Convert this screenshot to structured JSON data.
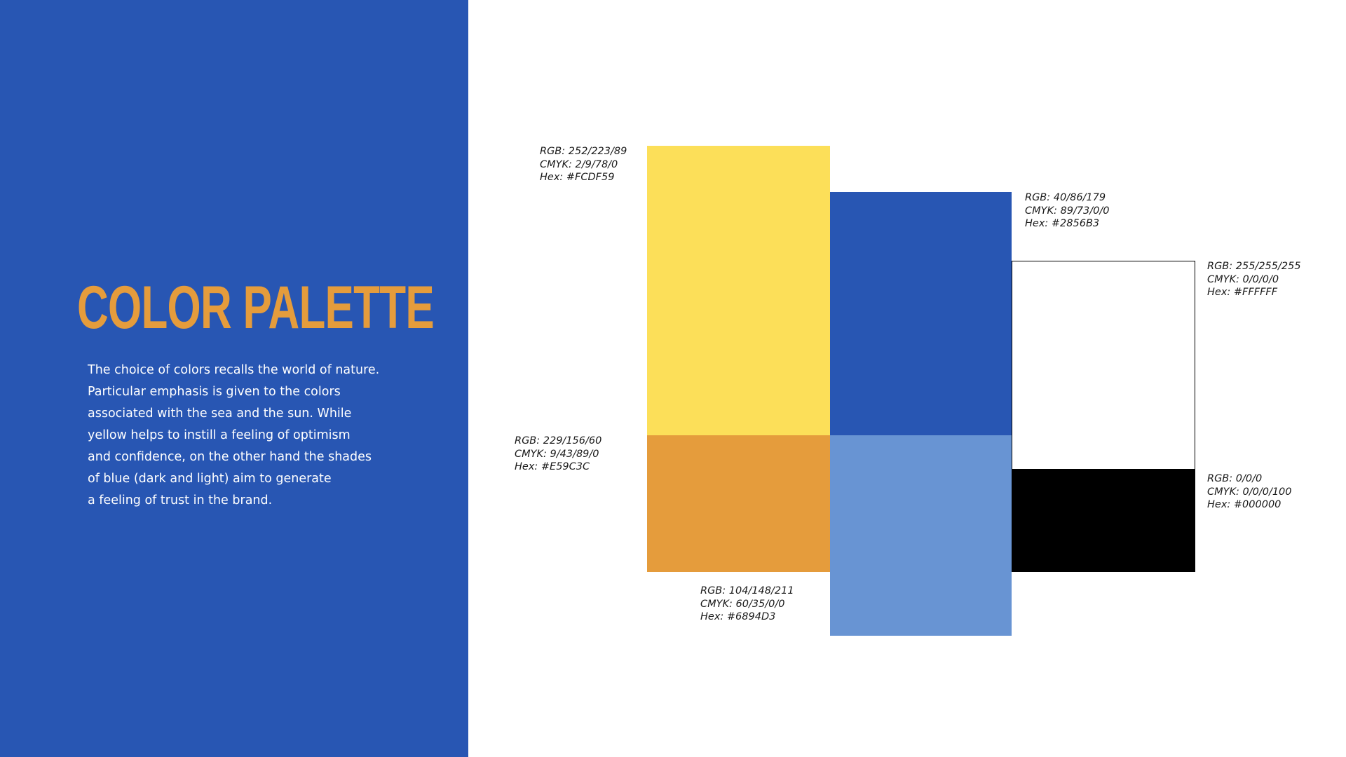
{
  "title": "COLOR PALETTE",
  "description_lines": [
    "The choice of colors recalls the world of nature.",
    "Particular emphasis is given to the colors",
    "associated with the sea and the sun. While",
    "yellow helps to instill a feeling of optimism",
    "and confidence, on the other hand the shades",
    "of blue (dark and light) aim to generate",
    "a feeling of trust in the brand."
  ],
  "colors": {
    "panel_background": "#2856B3",
    "title": "#E59C3C",
    "description_text": "#FFFFFF"
  },
  "swatches": {
    "yellow": {
      "color": "#FCDF59",
      "rgb": "RGB: 252/223/89",
      "cmyk": "CMYK: 2/9/78/0",
      "hex": "Hex: #FCDF59"
    },
    "blue": {
      "color": "#2856B3",
      "rgb": "RGB: 40/86/179",
      "cmyk": "CMYK: 89/73/0/0",
      "hex": "Hex: #2856B3"
    },
    "white": {
      "color": "#FFFFFF",
      "rgb": "RGB: 255/255/255",
      "cmyk": "CMYK: 0/0/0/0",
      "hex": "Hex: #FFFFFF"
    },
    "orange": {
      "color": "#E59C3C",
      "rgb": "RGB: 229/156/60",
      "cmyk": "CMYK: 9/43/89/0",
      "hex": "Hex: #E59C3C"
    },
    "lightblue": {
      "color": "#6894D3",
      "rgb": "RGB: 104/148/211",
      "cmyk": "CMYK: 60/35/0/0",
      "hex": "Hex: #6894D3"
    },
    "black": {
      "color": "#000000",
      "rgb": "RGB: 0/0/0",
      "cmyk": "CMYK: 0/0/0/100",
      "hex": "Hex: #000000"
    }
  }
}
